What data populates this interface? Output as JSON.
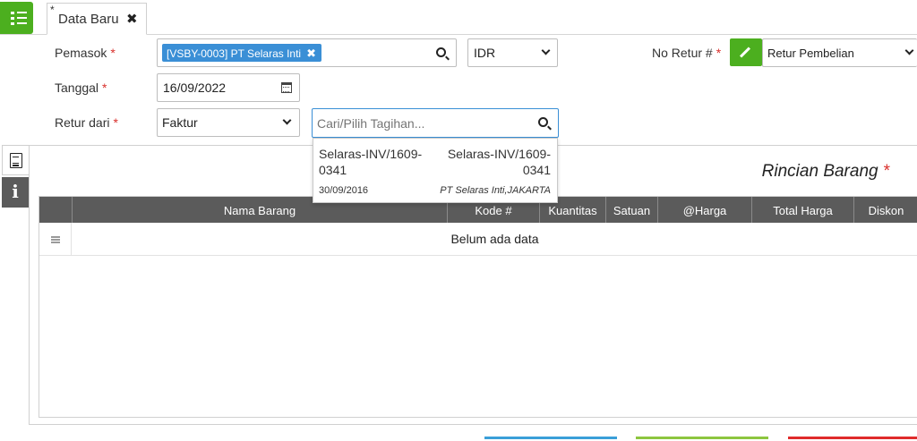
{
  "tab": {
    "modified_marker": "*",
    "title": "Data Baru",
    "close_glyph": "✖"
  },
  "form": {
    "pemasok": {
      "label": "Pemasok",
      "required_mark": "*",
      "value": "[VSBY-0003] PT Selaras Inti",
      "remove_glyph": "✖"
    },
    "currency": {
      "value": "IDR"
    },
    "no_retur": {
      "label": "No Retur #",
      "required_mark": "*",
      "value": "Retur Pembelian"
    },
    "tanggal": {
      "label": "Tanggal",
      "required_mark": "*",
      "value": "16/09/2022"
    },
    "retur_dari": {
      "label": "Retur dari",
      "required_mark": "*",
      "value": "Faktur"
    },
    "tagihan_search": {
      "placeholder": "Cari/Pilih Tagihan..."
    }
  },
  "dropdown": {
    "items": [
      {
        "invoice_no": "Selaras-INV/1609-0341",
        "reference": "Selaras-INV/1609-0341",
        "date": "30/09/2016",
        "supplier": "PT Selaras Inti,JAKARTA"
      }
    ]
  },
  "details": {
    "title": "Rincian Barang",
    "required_mark": "*",
    "columns": [
      "Nama Barang",
      "Kode #",
      "Kuantitas",
      "Satuan",
      "@Harga",
      "Total Harga",
      "Diskon"
    ],
    "empty_text": "Belum ada data"
  },
  "colors": {
    "accent_green": "#4caf1f",
    "tag_blue": "#3a8fd6",
    "header_gray": "#5b5b5b",
    "required_red": "#d9302c",
    "bottom_lines": [
      "#3a9fd8",
      "#8dc63f",
      "#e02b2b"
    ]
  },
  "icons": {
    "menu": "list-menu-icon",
    "search": "search-icon",
    "calendar": "calendar-icon",
    "edit": "pencil-icon",
    "document": "document-icon",
    "info": "info-icon"
  }
}
